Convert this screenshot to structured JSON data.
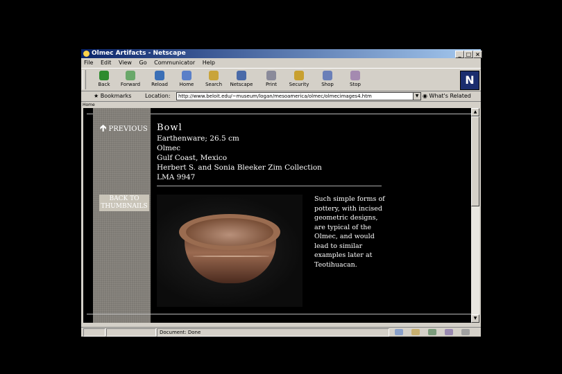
{
  "window": {
    "title": "Olmec Artifacts - Netscape",
    "controls": [
      "_",
      "□",
      "×"
    ]
  },
  "menu": [
    "File",
    "Edit",
    "View",
    "Go",
    "Communicator",
    "Help"
  ],
  "toolbar": {
    "buttons": [
      {
        "label": "Back",
        "icon": "back-arrow-icon",
        "color": "#2e8b2e"
      },
      {
        "label": "Forward",
        "icon": "forward-arrow-icon",
        "color": "#6aa86a"
      },
      {
        "label": "Reload",
        "icon": "reload-icon",
        "color": "#3b6fb6"
      },
      {
        "label": "Home",
        "icon": "home-icon",
        "color": "#5a7fc8"
      },
      {
        "label": "Search",
        "icon": "search-icon",
        "color": "#c9a43a"
      },
      {
        "label": "Netscape",
        "icon": "netscape-icon",
        "color": "#4a6aa8"
      },
      {
        "label": "Print",
        "icon": "print-icon",
        "color": "#8a8a9a"
      },
      {
        "label": "Security",
        "icon": "lock-icon",
        "color": "#c8a030"
      },
      {
        "label": "Shop",
        "icon": "shop-icon",
        "color": "#6a7fb8"
      },
      {
        "label": "Stop",
        "icon": "stop-icon",
        "color": "#a48ab0"
      }
    ],
    "logo": "N"
  },
  "location": {
    "bookmarks_label": "Bookmarks",
    "location_label": "Location:",
    "url": "http://www.beloit.edu/~museum/logan/mesoamerica/olmec/olmecimages4.htm",
    "related_label": "What's Related"
  },
  "tab_label": "Home",
  "page": {
    "previous_label": "PREVIOUS",
    "back_label_line1": "BACK TO",
    "back_label_line2": "THUMBNAILS",
    "artifact": {
      "title": "Bowl",
      "material": "Earthenware; 26.5 cm",
      "culture": "Olmec",
      "location": "Gulf Coast, Mexico",
      "collection": "Herbert S. and Sonia Bleeker Zim Collection",
      "catalog": "LMA 9947"
    },
    "description": "Such simple forms of pottery, with incised geometric designs, are typical of the Olmec, and would lead to similar examples later at Teotihuacan."
  },
  "status": {
    "text": "Document: Done"
  }
}
